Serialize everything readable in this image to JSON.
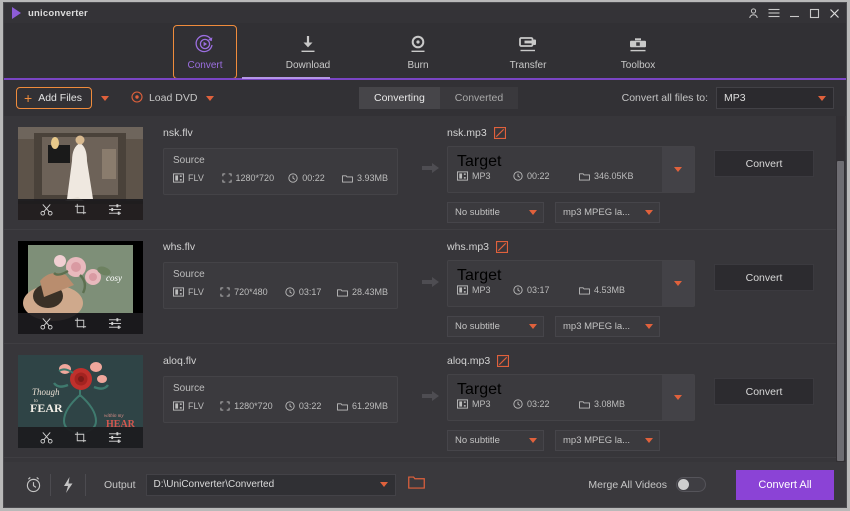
{
  "titlebar": {
    "app_name": "uniconverter",
    "logo_icon": "play-triangle-icon",
    "account_icon": "account-icon",
    "menu_icon": "hamburger-menu-icon",
    "minimize_icon": "minimize-icon",
    "maximize_icon": "maximize-icon",
    "close_icon": "close-icon"
  },
  "nav": {
    "items": [
      {
        "label": "Convert",
        "icon": "convert-circular-arrow-icon",
        "active": true
      },
      {
        "label": "Download",
        "icon": "download-arrow-icon",
        "active": false
      },
      {
        "label": "Burn",
        "icon": "burn-disc-icon",
        "active": false
      },
      {
        "label": "Transfer",
        "icon": "transfer-device-icon",
        "active": false
      },
      {
        "label": "Toolbox",
        "icon": "toolbox-icon",
        "active": false
      }
    ],
    "accent_color": "#f08c3c",
    "active_text_color": "#9b6ee0",
    "rule_color": "#7a45c4"
  },
  "toolbar": {
    "add_files_label": "Add Files",
    "add_files_icon": "plus-icon",
    "add_files_caret_icon": "chevron-down-icon",
    "load_dvd_label": "Load DVD",
    "load_dvd_icon": "disc-icon",
    "load_dvd_caret_icon": "chevron-down-icon",
    "tabs": [
      {
        "label": "Converting",
        "active": true
      },
      {
        "label": "Converted",
        "active": false
      }
    ],
    "convert_all_to_label": "Convert all files to:",
    "convert_all_to_value": "MP3",
    "convert_all_to_caret_icon": "chevron-down-icon"
  },
  "list": {
    "source_caption": "Source",
    "target_caption": "Target",
    "convert_button_label": "Convert",
    "arrow_icon": "right-arrow-icon",
    "edit_icon": "edit-pencil-icon",
    "thumb_tools": [
      "trim-scissors-icon",
      "crop-icon",
      "effect-sliders-icon"
    ],
    "chip_icons": {
      "format": "film-strip-icon",
      "resolution": "resize-frame-icon",
      "duration": "clock-icon",
      "size": "folder-icon"
    },
    "rows": [
      {
        "thumb": "bride-in-doorway",
        "source_name": "nsk.flv",
        "source": {
          "format": "FLV",
          "resolution": "1280*720",
          "duration": "00:22",
          "size": "3.93MB"
        },
        "target_name": "nsk.mp3",
        "target": {
          "format": "MP3",
          "duration": "00:22",
          "size": "346.05KB"
        },
        "subtitle": "No subtitle",
        "audio": "mp3 MPEG la..."
      },
      {
        "thumb": "woman-with-roses",
        "source_name": "whs.flv",
        "source": {
          "format": "FLV",
          "resolution": "720*480",
          "duration": "03:17",
          "size": "28.43MB"
        },
        "target_name": "whs.mp3",
        "target": {
          "format": "MP3",
          "duration": "03:17",
          "size": "4.53MB"
        },
        "subtitle": "No subtitle",
        "audio": "mp3 MPEG la..."
      },
      {
        "thumb": "rose-heart-illustration",
        "source_name": "aloq.flv",
        "source": {
          "format": "FLV",
          "resolution": "1280*720",
          "duration": "03:22",
          "size": "61.29MB"
        },
        "target_name": "aloq.mp3",
        "target": {
          "format": "MP3",
          "duration": "03:22",
          "size": "3.08MB"
        },
        "subtitle": "No subtitle",
        "audio": "mp3 MPEG la..."
      }
    ]
  },
  "bottom": {
    "schedule_icon": "alarm-clock-icon",
    "speed_icon": "lightning-bolt-icon",
    "output_label": "Output",
    "output_path": "D:\\UniConverter\\Converted",
    "output_caret_icon": "chevron-down-icon",
    "open_folder_icon": "open-folder-icon",
    "merge_label": "Merge All Videos",
    "merge_enabled": false,
    "convert_all_label": "Convert All",
    "convert_all_color": "#8b43d6"
  }
}
